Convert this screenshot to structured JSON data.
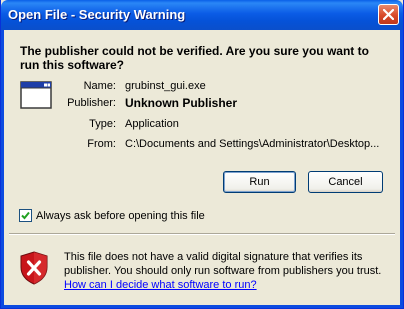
{
  "window": {
    "title": "Open File - Security Warning",
    "close_icon": "close-x-icon"
  },
  "headline": "The publisher could not be verified.  Are you sure you want to run this software?",
  "file_info": {
    "name_label": "Name:",
    "name_value": "grubinst_gui.exe",
    "publisher_label": "Publisher:",
    "publisher_value": "Unknown Publisher",
    "type_label": "Type:",
    "type_value": "Application",
    "from_label": "From:",
    "from_value": "C:\\Documents and Settings\\Administrator\\Desktop..."
  },
  "buttons": {
    "run": "Run",
    "cancel": "Cancel"
  },
  "checkbox": {
    "label": "Always ask before opening this file",
    "checked": true
  },
  "warning": {
    "text": "This file does not have a valid digital signature that verifies its publisher.  You should only run software from publishers you trust.",
    "link": "How can I decide what software to run?",
    "icon": "shield-warning-icon"
  },
  "colors": {
    "titlebar": "#0a5fe8",
    "dialog_bg": "#ece9d8",
    "close_button": "#d8492a",
    "link": "#0000ff"
  }
}
